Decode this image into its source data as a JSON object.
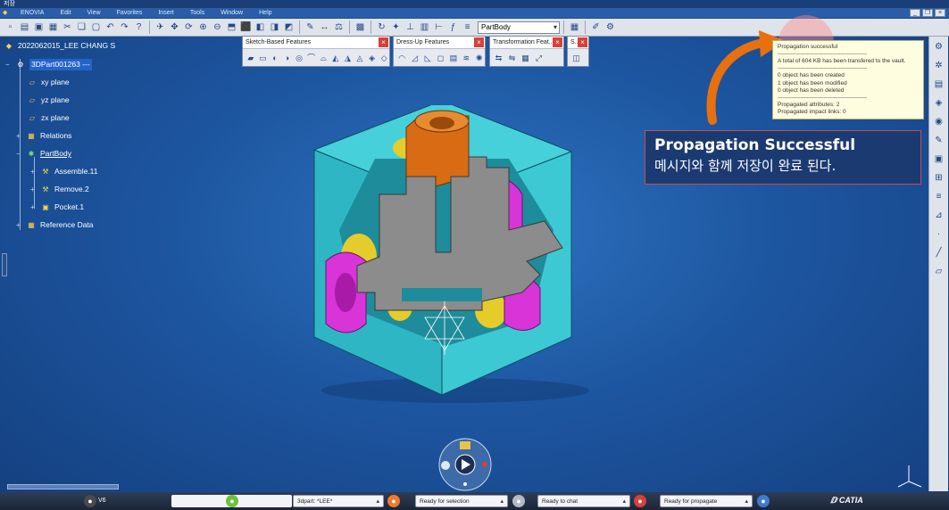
{
  "window": {
    "title": "저장"
  },
  "menu": [
    "ENOVIA",
    "Edit",
    "View",
    "Favorites",
    "Insert",
    "Tools",
    "Window",
    "Help"
  ],
  "toolbar": {
    "workbench_select": "PartBody"
  },
  "floating_toolbars": [
    {
      "title": "Sketch-Based Features",
      "icon_count": 12
    },
    {
      "title": "Dress-Up Features",
      "icon_count": 7
    },
    {
      "title": "Transformation Feat...",
      "icon_count": 5
    },
    {
      "title": "S..",
      "icon_count": 1
    }
  ],
  "tree": {
    "root": "2022062015_LEE CHANG S",
    "part": "3DPart001263 ---",
    "nodes": [
      {
        "label": "xy plane",
        "icon": "plane-icon"
      },
      {
        "label": "yz plane",
        "icon": "plane-icon"
      },
      {
        "label": "zx plane",
        "icon": "plane-icon"
      },
      {
        "label": "Relations",
        "icon": "relations-icon"
      },
      {
        "label": "PartBody",
        "icon": "partbody-icon"
      },
      {
        "label": "Assemble.11",
        "icon": "assemble-icon"
      },
      {
        "label": "Remove.2",
        "icon": "remove-icon"
      },
      {
        "label": "Pocket.1",
        "icon": "pocket-icon"
      },
      {
        "label": "Reference Data",
        "icon": "reference-data-icon"
      }
    ]
  },
  "message": {
    "title": "Propagation successful",
    "dashes": "------------------------------------------------------------",
    "line1": "A total of 604 KB has been transfered to the vault.",
    "created": "0 object has been created",
    "modified": "1 object has been modified",
    "deleted": "0 object has been deleted",
    "attributes": "Propagated attributes: 2",
    "impact_links": "Propagated impact links: 0"
  },
  "annotation": {
    "title": "Propagation Successful",
    "subtitle": "메시지와 함께 저장이 완료 된다."
  },
  "taskbar": {
    "start_label": "V6",
    "items": [
      {
        "label": "3dpart: *LEE*"
      },
      {
        "label": "Ready for selection"
      },
      {
        "label": "Ready to chat"
      },
      {
        "label": "Ready for propagate"
      }
    ],
    "brand": "CATIA"
  },
  "colors": {
    "background": "#1d56a0",
    "model_body": "#33c3cf",
    "model_section": "#8c8c8c",
    "model_holes": "#d834d8",
    "model_top": "#d96b14",
    "model_inner": "#e6cc2a",
    "annotation_arrow": "#e8700f",
    "popup_bg": "#fffde0"
  }
}
